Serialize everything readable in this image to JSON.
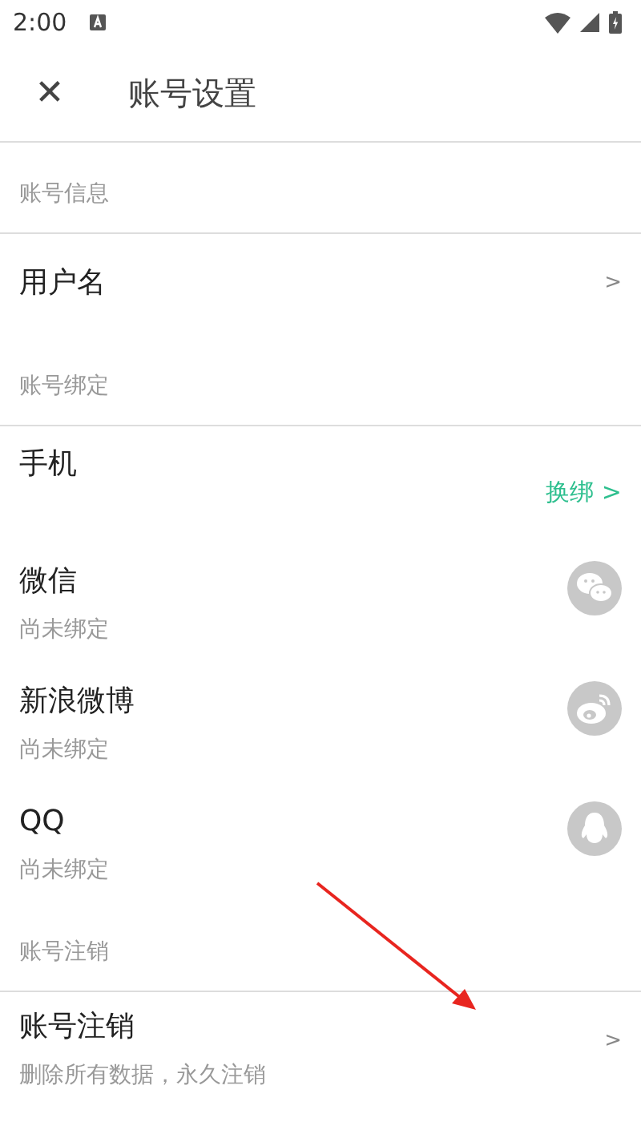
{
  "status_bar": {
    "time": "2:00"
  },
  "header": {
    "close": "✕",
    "title": "账号设置"
  },
  "sections": [
    {
      "label": "账号信息",
      "rows": [
        {
          "kind": "link",
          "title": "用户名",
          "chevron": ">"
        }
      ]
    },
    {
      "label": "账号绑定",
      "rows": [
        {
          "kind": "action",
          "title": "手机",
          "action": "换绑 >",
          "color": "#2dbf8e"
        },
        {
          "kind": "chat",
          "title": "微信",
          "subtitle": "尚未绑定"
        },
        {
          "kind": "eye",
          "title": "新浪微博",
          "subtitle": "尚未绑定"
        },
        {
          "kind": "penguin",
          "title": "QQ",
          "subtitle": "尚未绑定"
        }
      ]
    },
    {
      "label": "账号注销",
      "rows": [
        {
          "kind": "detail",
          "title": "账号注销",
          "subtitle": "删除所有数据，永久注销",
          "chevron": ">"
        }
      ]
    }
  ],
  "overlay": {
    "kind": "arrow"
  }
}
